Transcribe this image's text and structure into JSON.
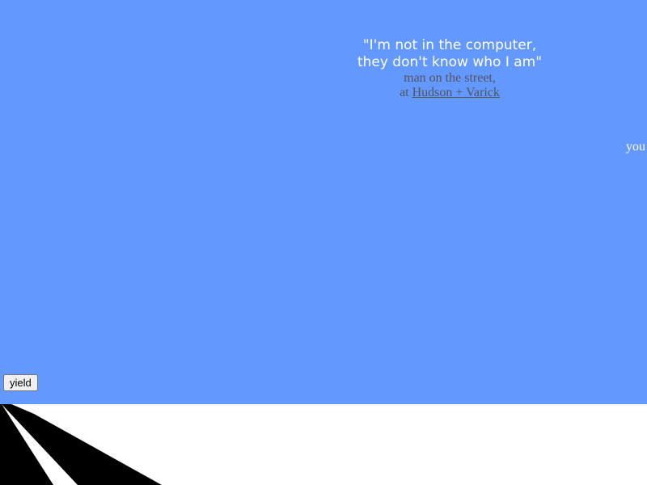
{
  "quote": {
    "line1": "\"I'm not in the computer,",
    "line2": "they don't know who I am\"",
    "attribution_line1": "man on the street,",
    "attribution_prefix": "at",
    "location_link": "Hudson + Varick"
  },
  "drift_text": "you",
  "controls": {
    "yield_label": "yield"
  },
  "colors": {
    "sky": "#6398ff",
    "ground": "#ffffff",
    "road": "#000000",
    "quote_text": "#ffffff",
    "attribution_text": "#555555"
  }
}
